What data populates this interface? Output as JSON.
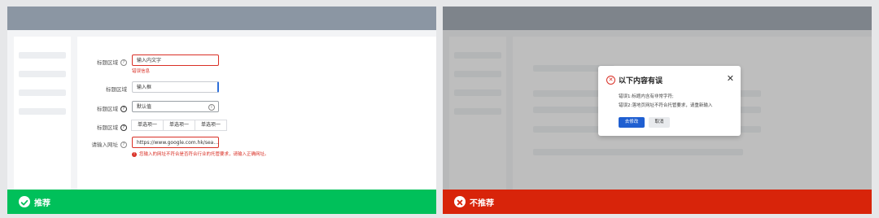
{
  "left": {
    "form": {
      "row1": {
        "label": "标题区域",
        "value": "输入内文字",
        "error": "错误信息"
      },
      "row2": {
        "label": "标题区域",
        "value": "输入框"
      },
      "row3": {
        "label": "标题区域",
        "value": "默认值"
      },
      "row4": {
        "label": "标题区域",
        "options": [
          "单选项一",
          "单选项一",
          "单选项一"
        ]
      },
      "row5": {
        "label": "请输入网址",
        "value": "https://www.google.com.hk/sea…",
        "error": "您输入的网址不符合是否符合行业的托管要求，请输入正确网址。"
      }
    },
    "footer": {
      "label": "推荐",
      "color": "#00c05a"
    }
  },
  "right": {
    "modal": {
      "title": "以下内容有误",
      "close": "✕",
      "line1": "错误1:标题内含有非常字符;",
      "line2": "错误2:落地页网址不符合托管要求，请重新输入",
      "primary_button": "去修改",
      "secondary_button": "取消"
    },
    "footer": {
      "label": "不推荐",
      "color": "#d8240a"
    }
  },
  "icons": {
    "ok": "check-circle-icon",
    "bad": "x-circle-icon",
    "help": "question-circle-icon",
    "info": "info-circle-icon"
  }
}
